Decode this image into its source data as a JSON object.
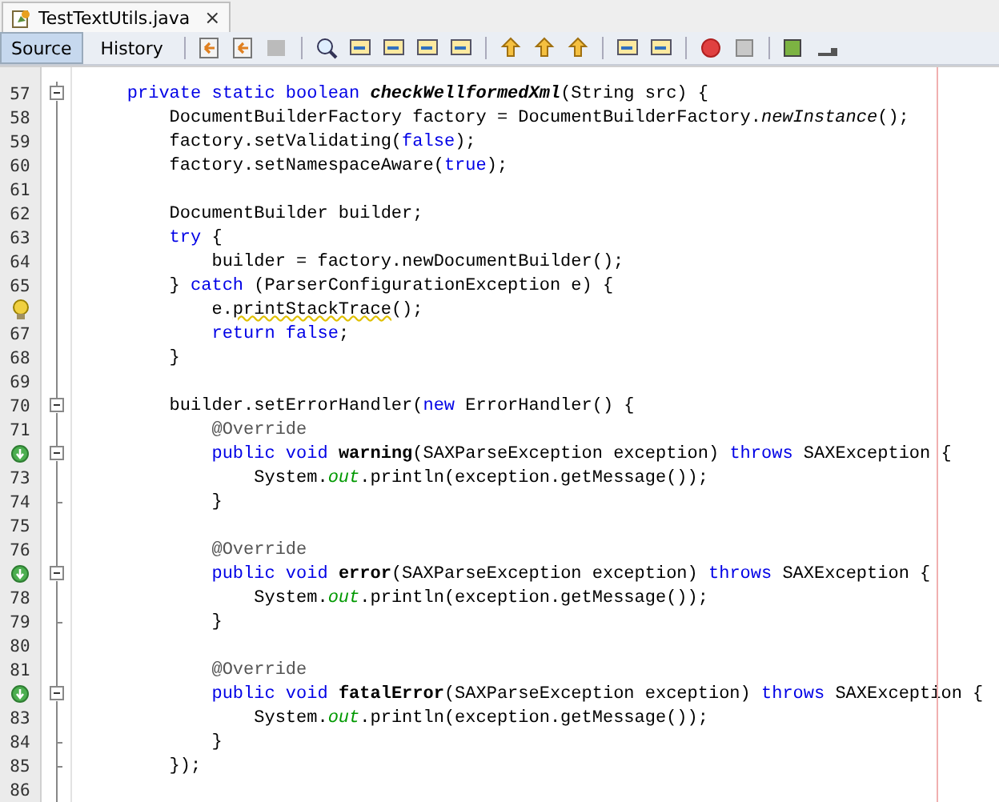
{
  "editor_tab": {
    "title": "TestTextUtils.java",
    "close": "×",
    "selected": true
  },
  "view_tabs": [
    {
      "label": "Source",
      "selected": true
    },
    {
      "label": "History",
      "selected": false
    }
  ],
  "lines": [
    {
      "number": "57",
      "fold": {
        "kind": "start"
      },
      "tokens": [
        {
          "kind": "keyword",
          "text": "    private static boolean "
        },
        {
          "kind": "method-static-decl",
          "text": "checkWellformedXml"
        },
        {
          "kind": "plain",
          "text": "(String src) {"
        }
      ]
    },
    {
      "number": "58",
      "fold": {
        "kind": "line"
      },
      "tokens": [
        {
          "kind": "plain",
          "text": "        DocumentBuilderFactory factory = DocumentBuilderFactory."
        },
        {
          "kind": "static-call",
          "text": "newInstance"
        },
        {
          "kind": "plain",
          "text": "();"
        }
      ]
    },
    {
      "number": "59",
      "fold": {
        "kind": "line"
      },
      "tokens": [
        {
          "kind": "plain",
          "text": "        factory.setValidating("
        },
        {
          "kind": "keyword",
          "text": "false"
        },
        {
          "kind": "plain",
          "text": ");"
        }
      ]
    },
    {
      "number": "60",
      "fold": {
        "kind": "line"
      },
      "tokens": [
        {
          "kind": "plain",
          "text": "        factory.setNamespaceAware("
        },
        {
          "kind": "keyword",
          "text": "true"
        },
        {
          "kind": "plain",
          "text": ");"
        }
      ]
    },
    {
      "number": "61",
      "fold": {
        "kind": "line"
      }
    },
    {
      "number": "62",
      "fold": {
        "kind": "line"
      },
      "tokens": [
        {
          "kind": "plain",
          "text": "        DocumentBuilder builder;"
        }
      ]
    },
    {
      "number": "63",
      "fold": {
        "kind": "line"
      },
      "tokens": [
        {
          "kind": "keyword",
          "text": "        try"
        },
        {
          "kind": "plain",
          "text": " {"
        }
      ]
    },
    {
      "number": "64",
      "fold": {
        "kind": "line"
      },
      "tokens": [
        {
          "kind": "plain",
          "text": "            builder = factory.newDocumentBuilder();"
        }
      ]
    },
    {
      "number": "65",
      "fold": {
        "kind": "line"
      },
      "tokens": [
        {
          "kind": "plain",
          "text": "        } "
        },
        {
          "kind": "keyword",
          "text": "catch"
        },
        {
          "kind": "plain",
          "text": " (ParserConfigurationException e) {"
        }
      ]
    },
    {
      "gutter_icon": {
        "kind": "hint"
      },
      "fold": {
        "kind": "line"
      },
      "tokens": [
        {
          "kind": "plain",
          "text": "            e."
        },
        {
          "kind": "hint",
          "text": "printStackTrace"
        },
        {
          "kind": "plain",
          "text": "();"
        }
      ]
    },
    {
      "number": "67",
      "fold": {
        "kind": "line"
      },
      "tokens": [
        {
          "kind": "keyword",
          "text": "            return false"
        },
        {
          "kind": "plain",
          "text": ";"
        }
      ]
    },
    {
      "number": "68",
      "fold": {
        "kind": "line"
      },
      "tokens": [
        {
          "kind": "plain",
          "text": "        }"
        }
      ]
    },
    {
      "number": "69",
      "fold": {
        "kind": "line"
      }
    },
    {
      "number": "70",
      "fold": {
        "kind": "start"
      },
      "tokens": [
        {
          "kind": "plain",
          "text": "        builder.setErrorHandler("
        },
        {
          "kind": "keyword",
          "text": "new"
        },
        {
          "kind": "plain",
          "text": " ErrorHandler() {"
        }
      ]
    },
    {
      "number": "71",
      "fold": {
        "kind": "line"
      },
      "tokens": [
        {
          "kind": "annotation",
          "text": "            @Override"
        }
      ]
    },
    {
      "gutter_icon": {
        "kind": "override"
      },
      "fold": {
        "kind": "start"
      },
      "tokens": [
        {
          "kind": "keyword",
          "text": "            public void "
        },
        {
          "kind": "method-decl",
          "text": "warning"
        },
        {
          "kind": "plain",
          "text": "(SAXParseException exception) "
        },
        {
          "kind": "keyword",
          "text": "throws"
        },
        {
          "kind": "plain",
          "text": " SAXException {"
        }
      ]
    },
    {
      "number": "73",
      "fold": {
        "kind": "line"
      },
      "tokens": [
        {
          "kind": "plain",
          "text": "                System."
        },
        {
          "kind": "field",
          "text": "out"
        },
        {
          "kind": "plain",
          "text": ".println(exception.getMessage());"
        }
      ]
    },
    {
      "number": "74",
      "fold": {
        "kind": "end"
      },
      "tokens": [
        {
          "kind": "plain",
          "text": "            }"
        }
      ]
    },
    {
      "number": "75",
      "fold": {
        "kind": "line"
      }
    },
    {
      "number": "76",
      "fold": {
        "kind": "line"
      },
      "tokens": [
        {
          "kind": "annotation",
          "text": "            @Override"
        }
      ]
    },
    {
      "gutter_icon": {
        "kind": "override"
      },
      "fold": {
        "kind": "start"
      },
      "tokens": [
        {
          "kind": "keyword",
          "text": "            public void "
        },
        {
          "kind": "method-decl",
          "text": "error"
        },
        {
          "kind": "plain",
          "text": "(SAXParseException exception) "
        },
        {
          "kind": "keyword",
          "text": "throws"
        },
        {
          "kind": "plain",
          "text": " SAXException {"
        }
      ]
    },
    {
      "number": "78",
      "fold": {
        "kind": "line"
      },
      "tokens": [
        {
          "kind": "plain",
          "text": "                System."
        },
        {
          "kind": "field",
          "text": "out"
        },
        {
          "kind": "plain",
          "text": ".println(exception.getMessage());"
        }
      ]
    },
    {
      "number": "79",
      "fold": {
        "kind": "end"
      },
      "tokens": [
        {
          "kind": "plain",
          "text": "            }"
        }
      ]
    },
    {
      "number": "80",
      "fold": {
        "kind": "line"
      }
    },
    {
      "number": "81",
      "fold": {
        "kind": "line"
      },
      "tokens": [
        {
          "kind": "annotation",
          "text": "            @Override"
        }
      ]
    },
    {
      "gutter_icon": {
        "kind": "override"
      },
      "fold": {
        "kind": "start"
      },
      "tokens": [
        {
          "kind": "keyword",
          "text": "            public void "
        },
        {
          "kind": "method-decl",
          "text": "fatalError"
        },
        {
          "kind": "plain",
          "text": "(SAXParseException exception) "
        },
        {
          "kind": "keyword",
          "text": "throws"
        },
        {
          "kind": "plain",
          "text": " SAXException {"
        }
      ]
    },
    {
      "number": "83",
      "fold": {
        "kind": "line"
      },
      "tokens": [
        {
          "kind": "plain",
          "text": "                System."
        },
        {
          "kind": "field",
          "text": "out"
        },
        {
          "kind": "plain",
          "text": ".println(exception.getMessage());"
        }
      ]
    },
    {
      "number": "84",
      "fold": {
        "kind": "end"
      },
      "tokens": [
        {
          "kind": "plain",
          "text": "            }"
        }
      ]
    },
    {
      "number": "85",
      "fold": {
        "kind": "end"
      },
      "tokens": [
        {
          "kind": "plain",
          "text": "        });"
        }
      ]
    },
    {
      "number": "86",
      "fold": {
        "kind": "line"
      }
    }
  ]
}
